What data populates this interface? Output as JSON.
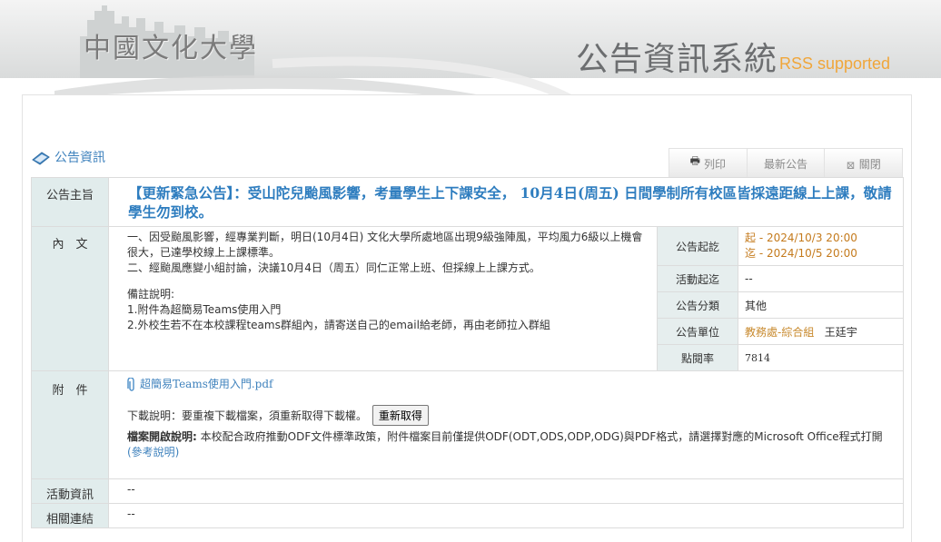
{
  "header": {
    "logo_text": "中國文化大學",
    "system_title": "公告資訊系統",
    "rss_text": "RSS supported"
  },
  "section": {
    "title": "公告資訊"
  },
  "toolbar": {
    "print_label": "列印",
    "latest_label": "最新公告",
    "close_label": "關閉"
  },
  "labels": {
    "subject": "公告主旨",
    "content": "內　文",
    "attachment": "附　件",
    "activity_info": "活動資訊",
    "related_links": "相關連結"
  },
  "announcement": {
    "title": "【更新緊急公告】：受山陀兒颱風影響，考量學生上下課安全， 10月4日(周五) 日間學制所有校區皆採遠距線上上課，敬請學生勿到校。",
    "content_lines": [
      "一、因受颱風影響，經專業判斷，明日(10月4日) 文化大學所處地區出現9級強陣風，平均風力6級以上機會很大，已達學校線上上課標準。",
      "二、經颱風應變小組討論，決議10月4日（周五）同仁正常上班、但採線上上課方式。"
    ],
    "notes_lines": [
      "備註說明:",
      "1.附件為超簡易Teams使用入門",
      "2.外校生若不在本校課程teams群組內，請寄送自己的email給老師，再由老師拉入群組"
    ]
  },
  "meta": {
    "period_label": "公告起訖",
    "period_start": "起 - 2024/10/3 20:00",
    "period_end": "迄 - 2024/10/5 20:00",
    "activity_period_label": "活動起迄",
    "activity_period_value": "--",
    "category_label": "公告分類",
    "category_value": "其他",
    "unit_label": "公告單位",
    "unit_dept": "教務處-綜合組",
    "unit_person": "王廷宇",
    "clicks_label": "點閱率",
    "clicks_value": "7814"
  },
  "attachment": {
    "file_name": "超簡易Teams使用入門.pdf",
    "download_note": "下載說明：要重複下載檔案，須重新取得下載權。",
    "refetch_button": "重新取得",
    "odf_label": "檔案開啟說明:",
    "odf_text": "本校配合政府推動ODF文件標準政策，附件檔案目前僅提供ODF(ODT,ODS,ODP,ODG)與PDF格式，請選擇對應的Microsoft Office程式打開",
    "odf_ref_link": "(參考說明)"
  },
  "activity_info_value": "--",
  "related_links_value": "--",
  "colors": {
    "accent_blue": "#3f82bd",
    "label_bg": "#e1ecec",
    "date_orange": "#c47a1c",
    "rss_orange": "#f0a63a"
  }
}
